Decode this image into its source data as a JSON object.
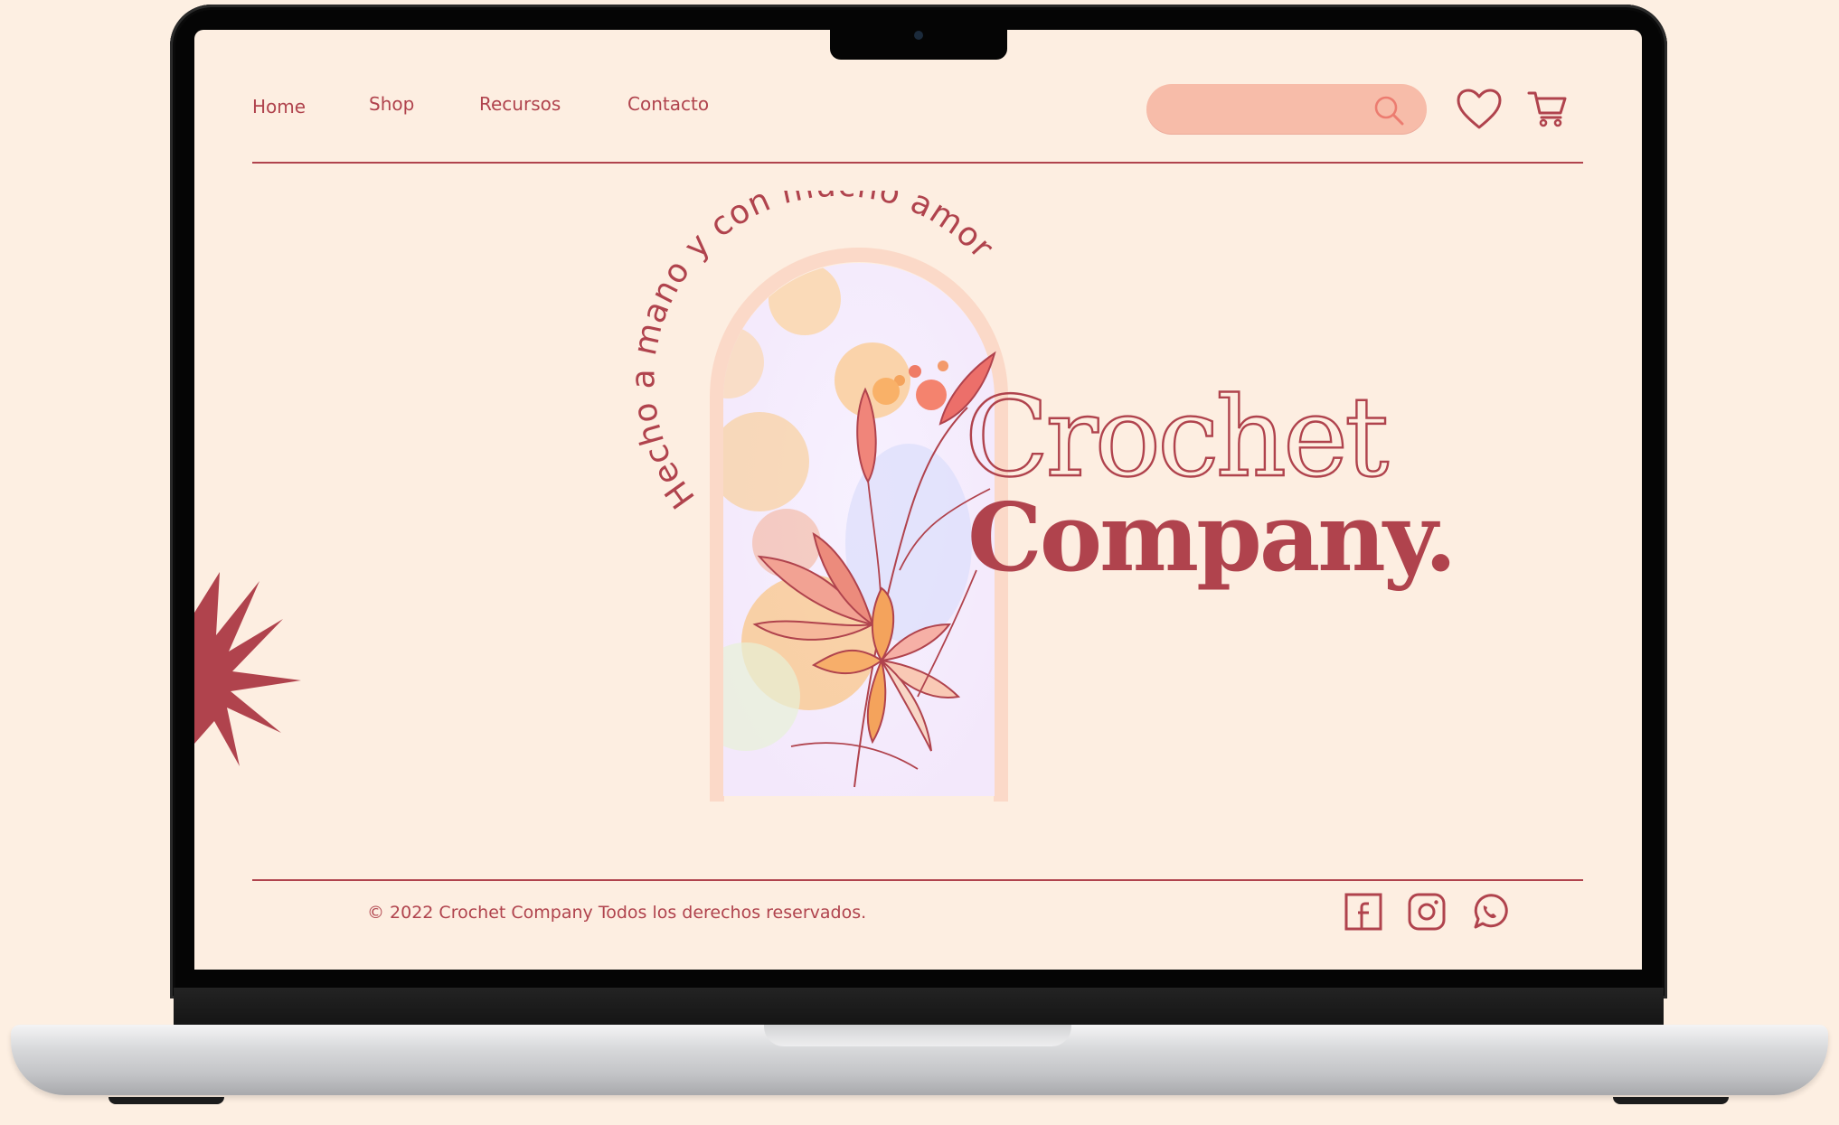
{
  "nav": {
    "items": [
      {
        "label": "Home"
      },
      {
        "label": "Shop"
      },
      {
        "label": "Recursos"
      },
      {
        "label": "Contacto"
      }
    ]
  },
  "search": {
    "placeholder": "",
    "value": "",
    "icon": "search-icon"
  },
  "header_icons": {
    "favorites": "heart-icon",
    "cart": "cart-icon"
  },
  "hero": {
    "arc_text": "Hecho a mano y con mucho amor",
    "title_line1": "Crochet",
    "title_line2": "Company."
  },
  "footer": {
    "copyright": "© 2022 Crochet Company Todos los derechos reservados.",
    "social": [
      "facebook-icon",
      "instagram-icon",
      "whatsapp-icon"
    ]
  },
  "colors": {
    "accent": "#b0434d",
    "background": "#fdeee1",
    "search_fill": "#f7bca9",
    "flower_orange": "#f4a35c",
    "flower_pink": "#ec6f6a"
  }
}
